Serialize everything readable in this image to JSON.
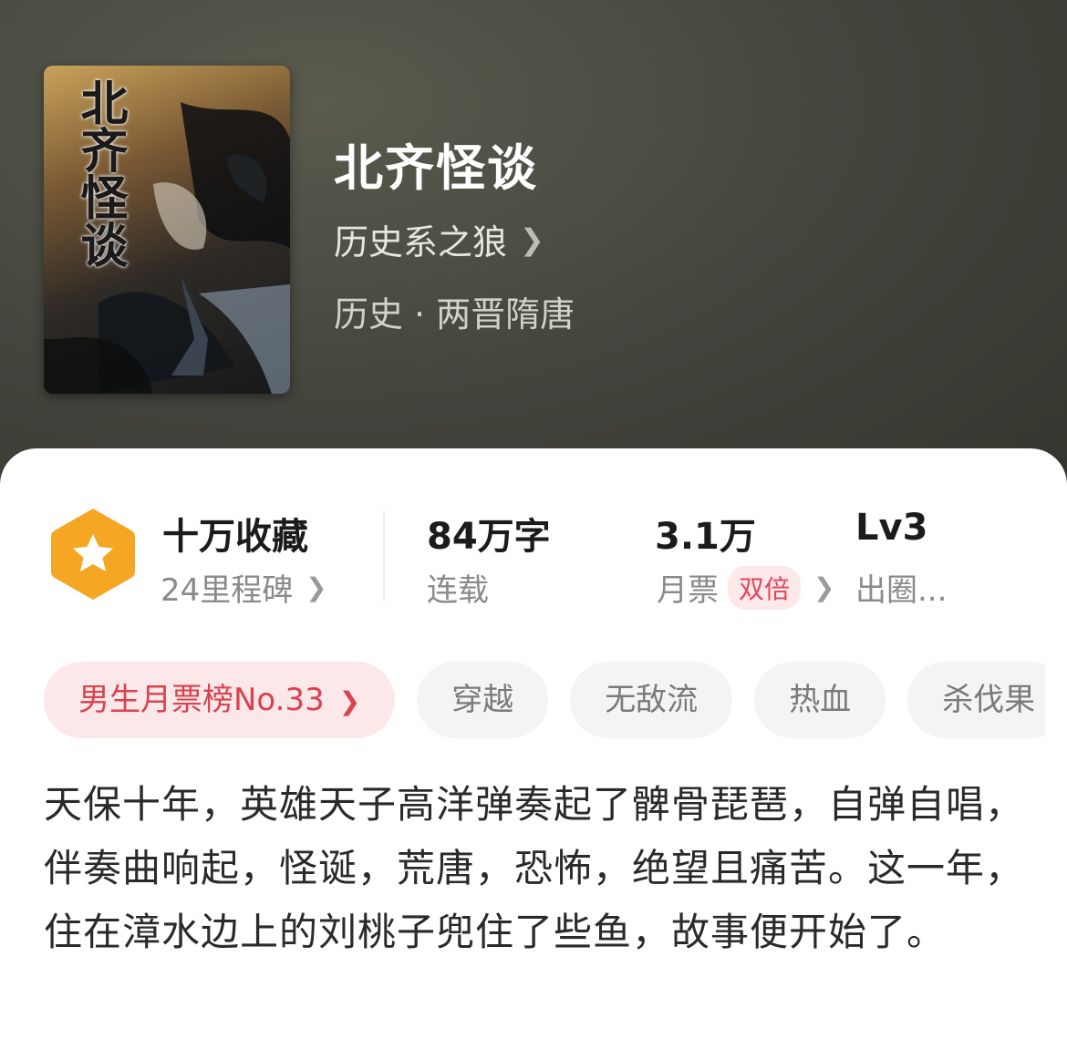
{
  "book": {
    "cover_title": "北齐怪谈",
    "title": "北齐怪谈",
    "author": "历史系之狼",
    "genre": "历史",
    "subgenre": "两晋隋唐",
    "genre_separator": "·"
  },
  "stats": {
    "favorites_main": "十万收藏",
    "milestones": "24里程碑",
    "words_main": "84万字",
    "words_sub": "连载",
    "tickets_main": "3.1万",
    "tickets_sub": "月票",
    "tickets_badge": "双倍",
    "level_main": "Lv3",
    "level_sub": "出圈..."
  },
  "tags": [
    {
      "label": "男生月票榜No.33",
      "kind": "rank"
    },
    {
      "label": "穿越",
      "kind": "tag"
    },
    {
      "label": "无敌流",
      "kind": "tag"
    },
    {
      "label": "热血",
      "kind": "tag"
    },
    {
      "label": "杀伐果",
      "kind": "tag"
    }
  ],
  "description": "天保十年，英雄天子高洋弹奏起了髀骨琵琶，自弹自唱，伴奏曲响起，怪诞，荒唐，恐怖，绝望且痛苦。这一年，住在漳水边上的刘桃子兜住了些鱼，故事便开始了。",
  "colors": {
    "hero_bg": "#46473f",
    "badge_orange": "#f5a623",
    "rank_text": "#d9424f",
    "rank_bg": "#fce8e9"
  },
  "icons": {
    "badge": "star-hexagon-icon",
    "chevron": "chevron-right-icon"
  }
}
